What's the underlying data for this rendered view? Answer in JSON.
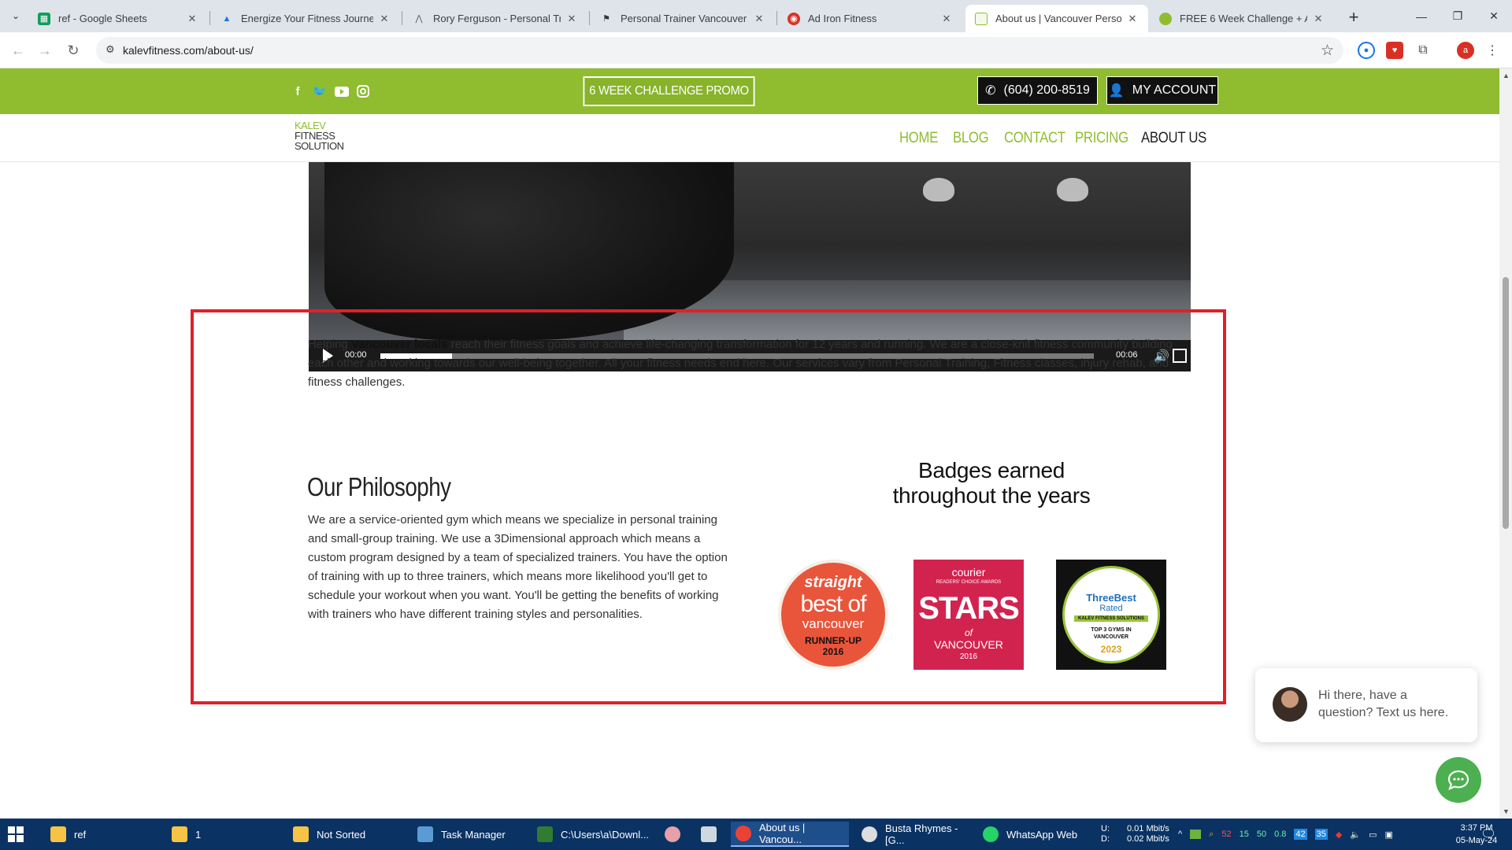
{
  "browser": {
    "tabs": [
      {
        "title": "ref - Google Sheets",
        "favicon": "sheets-icon",
        "color": "#0f9d58"
      },
      {
        "title": "Energize Your Fitness Journey w",
        "favicon": "mountain-icon",
        "color": "#1a73e8"
      },
      {
        "title": "Rory Ferguson - Personal Traini",
        "favicon": "mountain-icon",
        "color": "#5f6368"
      },
      {
        "title": "Personal Trainer Vancouver | W",
        "favicon": "runner-icon",
        "color": "#333333"
      },
      {
        "title": "Ad Iron Fitness",
        "favicon": "globe-icon",
        "color": "#d93025"
      },
      {
        "title": "About us | Vancouver Personal",
        "favicon": "page-icon",
        "color": "#8fbd2f"
      },
      {
        "title": "FREE 6 Week Challenge + Appl",
        "favicon": "apple-icon",
        "color": "#8fbd2f"
      }
    ],
    "active_tab": 5,
    "url": "kalevfitness.com/about-us/",
    "profile_initial": "a"
  },
  "site": {
    "promo_button": "6 WEEK CHALLENGE PROMO",
    "phone_button": "(604) 200-8519",
    "account_button": "MY ACCOUNT",
    "logo": {
      "line1": "KALEV",
      "line2": "FITNESS",
      "line3": "SOLUTION"
    },
    "nav": [
      "HOME",
      "BLOG",
      "CONTACT",
      "PRICING",
      "ABOUT US"
    ],
    "video": {
      "current_time": "00:00",
      "duration": "00:06",
      "progress": 0.1
    },
    "intro": {
      "pre": "Helping ",
      "bold": "Vancouver locals",
      "post": " reach their fitness goals and achieve life-changing transformation for 12 years and running. We are a close-knit fitness community building each other and working towards our well-being together. All your fitness needs end here. Our services vary from Personal Training, Fitness classes, injury rehab, and fitness challenges."
    },
    "philosophy_title": "Our Philosophy",
    "philosophy_text": "We are a service-oriented gym which means we specialize in personal training and small-group training. We use a 3Dimensional approach which means a custom program designed by a team of specialized trainers. You have the option of training with up to three trainers, which means more likelihood you'll get to schedule your workout when you want. You'll be getting the benefits of working with trainers who have different training styles and personalities.",
    "badges_title_1": "Badges earned",
    "badges_title_2": "throughout the years",
    "badges": [
      {
        "line1": "straight",
        "line2": "best of",
        "line3": "vancouver",
        "line4": "RUNNER-UP",
        "line5": "2016"
      },
      {
        "line1": "courier",
        "line2": "READERS' CHOICE AWARDS",
        "line3": "STARS",
        "line4": "of",
        "line5": "VANCOUVER",
        "line6": "2016"
      },
      {
        "line1": "ThreeBest",
        "line2": "Rated",
        "line3": "KALEV FITNESS SOLUTIONS",
        "line4": "TOP 3 GYMS IN VANCOUVER",
        "line5": "2023"
      }
    ],
    "chat_text": "Hi there, have a question? Text us here."
  },
  "taskbar": {
    "items": [
      "ref",
      "1",
      "Not Sorted",
      "Task Manager",
      "C:\\Users\\a\\Downl...",
      "",
      "",
      "About us | Vancou...",
      "Busta Rhymes - [G...",
      "WhatsApp Web"
    ],
    "net_up": "0.01 Mbit/s",
    "net_down": "0.02 Mbit/s",
    "net_up_label": "U:",
    "net_down_label": "D:",
    "tray_numbers": [
      "52",
      "15",
      "50",
      "0.8",
      "42",
      "35"
    ],
    "time": "3:37 PM",
    "date": "05-May-24"
  },
  "colors": {
    "brand_green": "#8fbd2f",
    "highlight_red": "#e0202a",
    "taskbar": "#0a3263"
  }
}
